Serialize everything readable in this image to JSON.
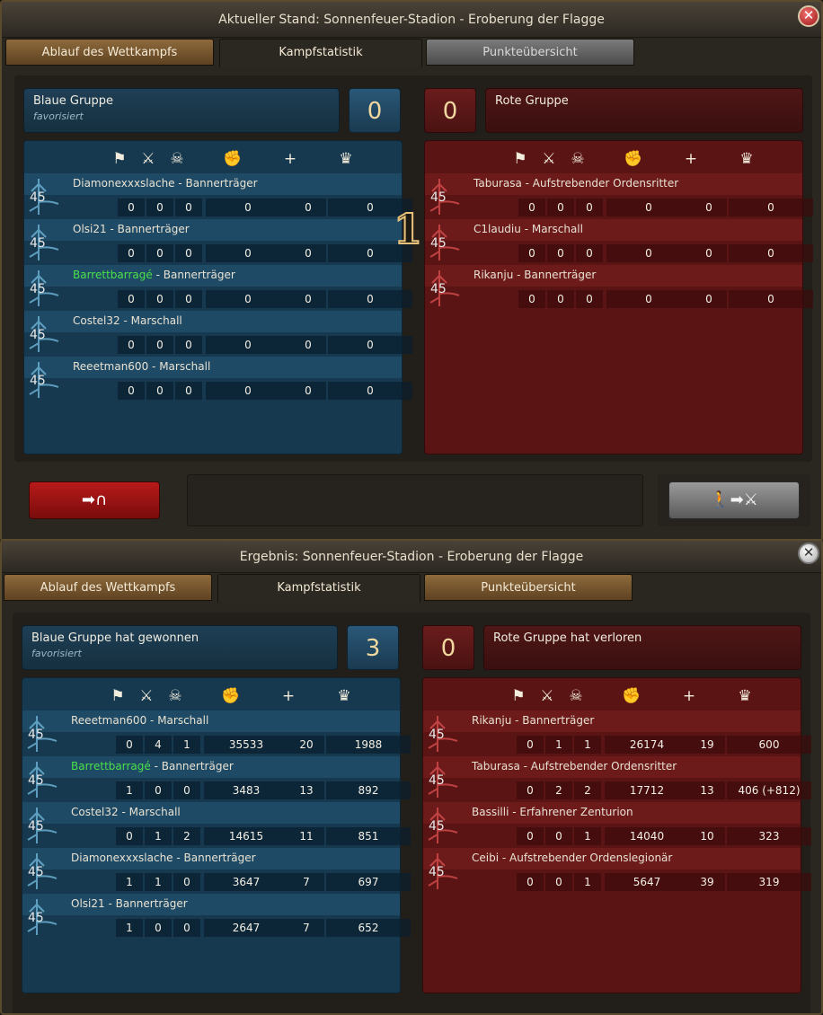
{
  "window1": {
    "title": "Aktueller Stand: Sonnenfeuer-Stadion - Eroberung der Flagge",
    "close_glyph": "✕",
    "tabs": [
      "Ablauf des Wettkampfs",
      "Kampfstatistik",
      "Punkteübersicht"
    ],
    "blue": {
      "name": "Blaue Gruppe",
      "subtitle": "favorisiert",
      "score": "0",
      "players": [
        {
          "name": "Diamonexxxslache",
          "role": "Bannerträger",
          "level": "45",
          "highlight": false,
          "stats": [
            "0",
            "0",
            "0",
            "0",
            "0",
            "0"
          ]
        },
        {
          "name": "Olsi21",
          "role": "Bannerträger",
          "level": "45",
          "highlight": false,
          "stats": [
            "0",
            "0",
            "0",
            "0",
            "0",
            "0"
          ]
        },
        {
          "name": "Barrettbarragé",
          "role": "Bannerträger",
          "level": "45",
          "highlight": true,
          "stats": [
            "0",
            "0",
            "0",
            "0",
            "0",
            "0"
          ]
        },
        {
          "name": "Costel32",
          "role": "Marschall",
          "level": "45",
          "highlight": false,
          "stats": [
            "0",
            "0",
            "0",
            "0",
            "0",
            "0"
          ]
        },
        {
          "name": "Reeetman600",
          "role": "Marschall",
          "level": "45",
          "highlight": false,
          "stats": [
            "0",
            "0",
            "0",
            "0",
            "0",
            "0"
          ]
        }
      ]
    },
    "red": {
      "name": "Rote Gruppe",
      "score": "0",
      "players": [
        {
          "name": "Taburasa",
          "role": "Aufstrebender Ordensritter",
          "level": "45",
          "stats": [
            "0",
            "0",
            "0",
            "0",
            "0",
            "0"
          ]
        },
        {
          "name": "C1laudiu",
          "role": "Marschall",
          "level": "45",
          "stats": [
            "0",
            "0",
            "0",
            "0",
            "0",
            "0"
          ]
        },
        {
          "name": "Rikanju",
          "role": "Bannerträger",
          "level": "45",
          "stats": [
            "0",
            "0",
            "0",
            "0",
            "0",
            "0"
          ]
        }
      ]
    },
    "mid_number": "1",
    "leave_glyph": "➡∩",
    "join_glyph": "🚶➡⚔"
  },
  "window2": {
    "title": "Ergebnis: Sonnenfeuer-Stadion - Eroberung der Flagge",
    "close_glyph": "✕",
    "tabs": [
      "Ablauf des Wettkampfs",
      "Kampfstatistik",
      "Punkteübersicht"
    ],
    "blue": {
      "name": "Blaue Gruppe hat gewonnen",
      "subtitle": "favorisiert",
      "score": "3",
      "players": [
        {
          "name": "Reeetman600",
          "role": "Marschall",
          "level": "45",
          "highlight": false,
          "stats": [
            "0",
            "4",
            "1",
            "35533",
            "20",
            "1988"
          ]
        },
        {
          "name": "Barrettbarragé",
          "role": "Bannerträger",
          "level": "45",
          "highlight": true,
          "stats": [
            "1",
            "0",
            "0",
            "3483",
            "13",
            "892"
          ]
        },
        {
          "name": "Costel32",
          "role": "Marschall",
          "level": "45",
          "highlight": false,
          "stats": [
            "0",
            "1",
            "2",
            "14615",
            "11",
            "851"
          ]
        },
        {
          "name": "Diamonexxxslache",
          "role": "Bannerträger",
          "level": "45",
          "highlight": false,
          "stats": [
            "1",
            "1",
            "0",
            "3647",
            "7",
            "697"
          ]
        },
        {
          "name": "Olsi21",
          "role": "Bannerträger",
          "level": "45",
          "highlight": false,
          "stats": [
            "1",
            "0",
            "0",
            "2647",
            "7",
            "652"
          ]
        }
      ]
    },
    "red": {
      "name": "Rote Gruppe hat verloren",
      "score": "0",
      "players": [
        {
          "name": "Rikanju",
          "role": "Bannerträger",
          "level": "45",
          "stats": [
            "0",
            "1",
            "1",
            "26174",
            "19",
            "600"
          ]
        },
        {
          "name": "Taburasa",
          "role": "Aufstrebender Ordensritter",
          "level": "45",
          "stats": [
            "0",
            "2",
            "2",
            "17712",
            "13",
            "406 (+812)"
          ]
        },
        {
          "name": "Bassilli",
          "role": "Erfahrener Zenturion",
          "level": "45",
          "stats": [
            "0",
            "0",
            "1",
            "14040",
            "10",
            "323"
          ]
        },
        {
          "name": "Ceibi",
          "role": "Aufstrebender Ordenslegionär",
          "level": "45",
          "stats": [
            "0",
            "0",
            "1",
            "5647",
            "39",
            "319"
          ]
        }
      ]
    }
  },
  "stat_icons": [
    "flag-icon",
    "crossed-swords-icon",
    "skull-icon",
    "fist-icon",
    "plus-icon",
    "crown-icon"
  ],
  "stat_glyphs": [
    "⚑",
    "⚔",
    "☠",
    "✊",
    "+",
    "♛"
  ],
  "colors": {
    "blue_panel": "#16394f",
    "red_panel": "#5a1414",
    "gold": "#e8c27a",
    "highlight_name": "#4ae04a"
  }
}
